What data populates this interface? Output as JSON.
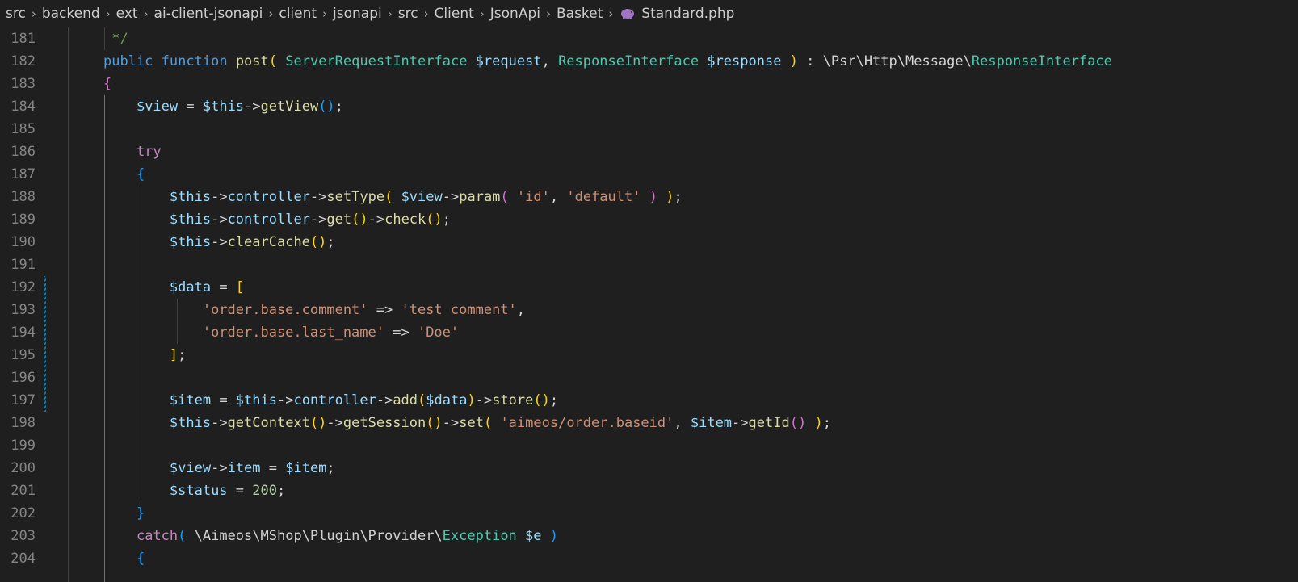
{
  "breadcrumb": {
    "items": [
      "src",
      "backend",
      "ext",
      "ai-client-jsonapi",
      "client",
      "jsonapi",
      "src",
      "Client",
      "JsonApi",
      "Basket"
    ],
    "file": "Standard.php",
    "file_icon": "php-elephant-icon"
  },
  "editor": {
    "language": "php",
    "theme_colors": {
      "background": "#1f1f1f",
      "line_number": "#858585",
      "keyword": "#569cd6",
      "control": "#c586c0",
      "variable": "#9cdcfe",
      "function": "#dcdcaa",
      "type": "#4ec9b0",
      "string": "#ce9178",
      "number": "#b5cea8",
      "comment": "#6a9955",
      "bracket_1": "#ffd700",
      "bracket_2": "#da70d6",
      "bracket_3": "#179fff",
      "modified_gutter": "#1b81a8"
    },
    "modified_lines": [
      192,
      193,
      194,
      195,
      196,
      197
    ],
    "lines": [
      {
        "number": "181",
        "tokens": [
          {
            "t": "cmt",
            "v": " */"
          }
        ]
      },
      {
        "number": "182",
        "tokens": [
          {
            "t": "kw",
            "v": "public"
          },
          {
            "t": "op",
            "v": " "
          },
          {
            "t": "kw",
            "v": "function"
          },
          {
            "t": "op",
            "v": " "
          },
          {
            "t": "fn",
            "v": "post"
          },
          {
            "t": "b1",
            "v": "("
          },
          {
            "t": "op",
            "v": " "
          },
          {
            "t": "type",
            "v": "ServerRequestInterface"
          },
          {
            "t": "op",
            "v": " "
          },
          {
            "t": "var",
            "v": "$request"
          },
          {
            "t": "op",
            "v": ", "
          },
          {
            "t": "type",
            "v": "ResponseInterface"
          },
          {
            "t": "op",
            "v": " "
          },
          {
            "t": "var",
            "v": "$response"
          },
          {
            "t": "op",
            "v": " "
          },
          {
            "t": "b1",
            "v": ")"
          },
          {
            "t": "op",
            "v": " : \\Psr\\Http\\Message\\"
          },
          {
            "t": "type",
            "v": "ResponseInterface"
          }
        ]
      },
      {
        "number": "183",
        "tokens": [
          {
            "t": "b2",
            "v": "{"
          }
        ]
      },
      {
        "number": "184",
        "tokens": [
          {
            "t": "op",
            "v": "    "
          },
          {
            "t": "var",
            "v": "$view"
          },
          {
            "t": "op",
            "v": " = "
          },
          {
            "t": "var",
            "v": "$this"
          },
          {
            "t": "op",
            "v": "->"
          },
          {
            "t": "fn",
            "v": "getView"
          },
          {
            "t": "b3",
            "v": "()"
          },
          {
            "t": "op",
            "v": ";"
          }
        ]
      },
      {
        "number": "185",
        "tokens": []
      },
      {
        "number": "186",
        "tokens": [
          {
            "t": "op",
            "v": "    "
          },
          {
            "t": "ctl",
            "v": "try"
          }
        ]
      },
      {
        "number": "187",
        "tokens": [
          {
            "t": "op",
            "v": "    "
          },
          {
            "t": "b3",
            "v": "{"
          }
        ]
      },
      {
        "number": "188",
        "tokens": [
          {
            "t": "op",
            "v": "        "
          },
          {
            "t": "var",
            "v": "$this"
          },
          {
            "t": "op",
            "v": "->"
          },
          {
            "t": "var",
            "v": "controller"
          },
          {
            "t": "op",
            "v": "->"
          },
          {
            "t": "fn",
            "v": "setType"
          },
          {
            "t": "b1",
            "v": "("
          },
          {
            "t": "op",
            "v": " "
          },
          {
            "t": "var",
            "v": "$view"
          },
          {
            "t": "op",
            "v": "->"
          },
          {
            "t": "fn",
            "v": "param"
          },
          {
            "t": "b2",
            "v": "("
          },
          {
            "t": "op",
            "v": " "
          },
          {
            "t": "str",
            "v": "'id'"
          },
          {
            "t": "op",
            "v": ", "
          },
          {
            "t": "str",
            "v": "'default'"
          },
          {
            "t": "op",
            "v": " "
          },
          {
            "t": "b2",
            "v": ")"
          },
          {
            "t": "op",
            "v": " "
          },
          {
            "t": "b1",
            "v": ")"
          },
          {
            "t": "op",
            "v": ";"
          }
        ]
      },
      {
        "number": "189",
        "tokens": [
          {
            "t": "op",
            "v": "        "
          },
          {
            "t": "var",
            "v": "$this"
          },
          {
            "t": "op",
            "v": "->"
          },
          {
            "t": "var",
            "v": "controller"
          },
          {
            "t": "op",
            "v": "->"
          },
          {
            "t": "fn",
            "v": "get"
          },
          {
            "t": "b1",
            "v": "()"
          },
          {
            "t": "op",
            "v": "->"
          },
          {
            "t": "fn",
            "v": "check"
          },
          {
            "t": "b1",
            "v": "()"
          },
          {
            "t": "op",
            "v": ";"
          }
        ]
      },
      {
        "number": "190",
        "tokens": [
          {
            "t": "op",
            "v": "        "
          },
          {
            "t": "var",
            "v": "$this"
          },
          {
            "t": "op",
            "v": "->"
          },
          {
            "t": "fn",
            "v": "clearCache"
          },
          {
            "t": "b1",
            "v": "()"
          },
          {
            "t": "op",
            "v": ";"
          }
        ]
      },
      {
        "number": "191",
        "tokens": []
      },
      {
        "number": "192",
        "tokens": [
          {
            "t": "op",
            "v": "        "
          },
          {
            "t": "var",
            "v": "$data"
          },
          {
            "t": "op",
            "v": " = "
          },
          {
            "t": "b1",
            "v": "["
          }
        ]
      },
      {
        "number": "193",
        "tokens": [
          {
            "t": "op",
            "v": "            "
          },
          {
            "t": "str",
            "v": "'order.base.comment'"
          },
          {
            "t": "op",
            "v": " => "
          },
          {
            "t": "str",
            "v": "'test comment'"
          },
          {
            "t": "op",
            "v": ","
          }
        ]
      },
      {
        "number": "194",
        "tokens": [
          {
            "t": "op",
            "v": "            "
          },
          {
            "t": "str",
            "v": "'order.base.last_name'"
          },
          {
            "t": "op",
            "v": " => "
          },
          {
            "t": "str",
            "v": "'Doe'"
          }
        ]
      },
      {
        "number": "195",
        "tokens": [
          {
            "t": "op",
            "v": "        "
          },
          {
            "t": "b1",
            "v": "]"
          },
          {
            "t": "op",
            "v": ";"
          }
        ]
      },
      {
        "number": "196",
        "tokens": []
      },
      {
        "number": "197",
        "tokens": [
          {
            "t": "op",
            "v": "        "
          },
          {
            "t": "var",
            "v": "$item"
          },
          {
            "t": "op",
            "v": " = "
          },
          {
            "t": "var",
            "v": "$this"
          },
          {
            "t": "op",
            "v": "->"
          },
          {
            "t": "var",
            "v": "controller"
          },
          {
            "t": "op",
            "v": "->"
          },
          {
            "t": "fn",
            "v": "add"
          },
          {
            "t": "b1",
            "v": "("
          },
          {
            "t": "var",
            "v": "$data"
          },
          {
            "t": "b1",
            "v": ")"
          },
          {
            "t": "op",
            "v": "->"
          },
          {
            "t": "fn",
            "v": "store"
          },
          {
            "t": "b1",
            "v": "()"
          },
          {
            "t": "op",
            "v": ";"
          }
        ]
      },
      {
        "number": "198",
        "tokens": [
          {
            "t": "op",
            "v": "        "
          },
          {
            "t": "var",
            "v": "$this"
          },
          {
            "t": "op",
            "v": "->"
          },
          {
            "t": "fn",
            "v": "getContext"
          },
          {
            "t": "b1",
            "v": "()"
          },
          {
            "t": "op",
            "v": "->"
          },
          {
            "t": "fn",
            "v": "getSession"
          },
          {
            "t": "b1",
            "v": "()"
          },
          {
            "t": "op",
            "v": "->"
          },
          {
            "t": "fn",
            "v": "set"
          },
          {
            "t": "b1",
            "v": "("
          },
          {
            "t": "op",
            "v": " "
          },
          {
            "t": "str",
            "v": "'aimeos/order.baseid'"
          },
          {
            "t": "op",
            "v": ", "
          },
          {
            "t": "var",
            "v": "$item"
          },
          {
            "t": "op",
            "v": "->"
          },
          {
            "t": "fn",
            "v": "getId"
          },
          {
            "t": "b2",
            "v": "()"
          },
          {
            "t": "op",
            "v": " "
          },
          {
            "t": "b1",
            "v": ")"
          },
          {
            "t": "op",
            "v": ";"
          }
        ]
      },
      {
        "number": "199",
        "tokens": []
      },
      {
        "number": "200",
        "tokens": [
          {
            "t": "op",
            "v": "        "
          },
          {
            "t": "var",
            "v": "$view"
          },
          {
            "t": "op",
            "v": "->"
          },
          {
            "t": "var",
            "v": "item"
          },
          {
            "t": "op",
            "v": " = "
          },
          {
            "t": "var",
            "v": "$item"
          },
          {
            "t": "op",
            "v": ";"
          }
        ]
      },
      {
        "number": "201",
        "tokens": [
          {
            "t": "op",
            "v": "        "
          },
          {
            "t": "var",
            "v": "$status"
          },
          {
            "t": "op",
            "v": " = "
          },
          {
            "t": "num",
            "v": "200"
          },
          {
            "t": "op",
            "v": ";"
          }
        ]
      },
      {
        "number": "202",
        "tokens": [
          {
            "t": "op",
            "v": "    "
          },
          {
            "t": "b3",
            "v": "}"
          }
        ]
      },
      {
        "number": "203",
        "tokens": [
          {
            "t": "op",
            "v": "    "
          },
          {
            "t": "ctl",
            "v": "catch"
          },
          {
            "t": "b3",
            "v": "("
          },
          {
            "t": "op",
            "v": " \\Aimeos\\MShop\\Plugin\\Provider\\"
          },
          {
            "t": "type",
            "v": "Exception"
          },
          {
            "t": "op",
            "v": " "
          },
          {
            "t": "var",
            "v": "$e"
          },
          {
            "t": "op",
            "v": " "
          },
          {
            "t": "b3",
            "v": ")"
          }
        ]
      },
      {
        "number": "204",
        "tokens": [
          {
            "t": "op",
            "v": "    "
          },
          {
            "t": "b3",
            "v": "{"
          }
        ]
      }
    ]
  }
}
